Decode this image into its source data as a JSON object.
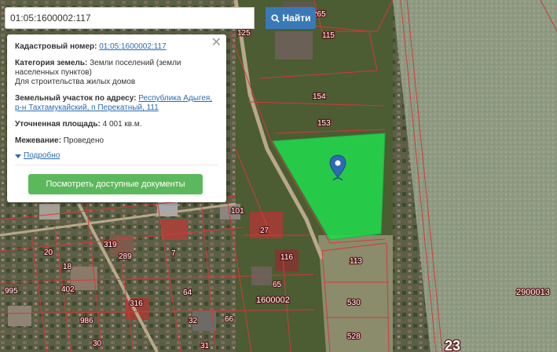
{
  "search": {
    "value": "01:05:1600002:117",
    "button_label": "Найти"
  },
  "card": {
    "cadastral_label": "Кадастровый номер:",
    "cadastral_value": "01:05:1600002:117",
    "category_label": "Категория земель:",
    "category_value": "Земли поселений (земли населенных пунктов)",
    "use_value": "Для строительства жилых домов",
    "address_label": "Земельный участок по адресу:",
    "address_value": "Республика Адыгея, р-н Тахтамукайский, п Перекатный, 111",
    "area_label": "Уточненная площадь:",
    "area_value": "4 001 кв.м.",
    "survey_label": "Межевание:",
    "survey_value": "Проведено",
    "more_label": "Подробно",
    "docs_button_label": "Посмотреть доступные документы"
  },
  "map_labels": {
    "l265": "265",
    "l125": "125",
    "l115": "115",
    "l154": "154",
    "l153": "153",
    "l101": "101",
    "l27": "27",
    "l116": "116",
    "l113": "113",
    "l65": "65",
    "l530": "530",
    "l528": "528",
    "l319": "319",
    "l289": "289",
    "l20": "20",
    "l18": "18",
    "l402": "402",
    "l316": "316",
    "l64": "64",
    "l32": "32",
    "l66": "66",
    "l986": "986",
    "l7": "7",
    "l31": "31",
    "l30": "30",
    "l1600002": "1600002",
    "l2900013": "2900013",
    "l23": "23",
    "l995": "995"
  },
  "colors": {
    "parcel_fill": "#22d64a",
    "boundary": "#d23a3a",
    "pin": "#2a6cb0",
    "button_blue": "#3a79b8",
    "button_green": "#5cb85c"
  },
  "icons": {
    "search": "search-icon",
    "pin": "map-pin-icon",
    "close": "close-icon",
    "expand": "caret-down-icon"
  }
}
